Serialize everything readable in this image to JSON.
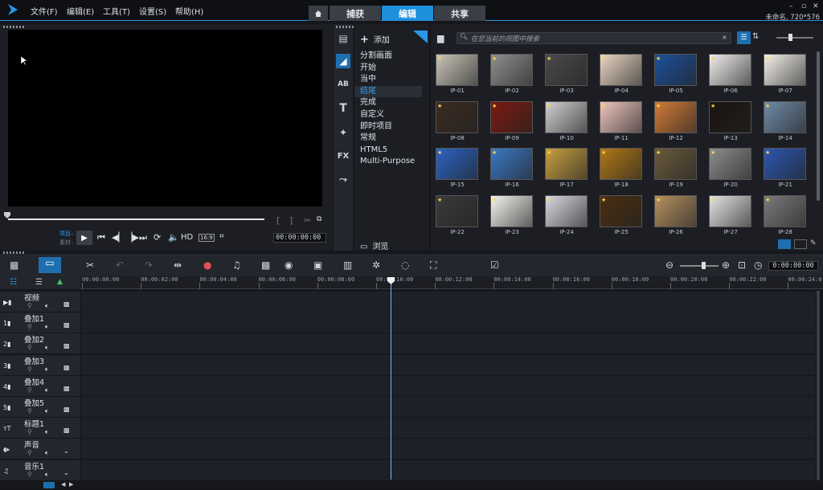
{
  "menu": [
    "文件(F)",
    "编辑(E)",
    "工具(T)",
    "设置(S)",
    "帮助(H)"
  ],
  "tabs": [
    "捕获",
    "编辑",
    "共享"
  ],
  "window_buttons": [
    "–",
    "▫",
    "✕"
  ],
  "project_info": "未命名, 720*576",
  "preview": {
    "project_label": "项目–",
    "clip_label": "素材–",
    "timecode": "00:00:00:00",
    "hd_label": "HD",
    "aspect_label": "16:9"
  },
  "library": {
    "add_label": "添加",
    "categories": [
      "分割画面",
      "开始",
      "当中",
      "结尾",
      "完成",
      "自定义",
      "即时项目",
      "常规",
      "HTML5",
      "Multi-Purpose"
    ],
    "active_category": "结尾",
    "browse_label": "浏览",
    "search_placeholder": "在您当前的视图中搜索",
    "thumbnails": [
      "IP-01",
      "IP-02",
      "IP-03",
      "IP-04",
      "IP-05",
      "IP-06",
      "IP-07",
      "IP-08",
      "IP-09",
      "IP-10",
      "IP-11",
      "IP-12",
      "IP-13",
      "IP-14",
      "IP-15",
      "IP-16",
      "IP-17",
      "IP-18",
      "IP-19",
      "IP-20",
      "IP-21",
      "IP-22",
      "IP-23",
      "IP-24",
      "IP-25",
      "IP-26",
      "IP-27",
      "IP-28"
    ],
    "thumb_colors": [
      "#c8c4b8",
      "#8f8f8f",
      "#4a4a4a",
      "#e9d6c4",
      "#1c4f9a",
      "#f0ecec",
      "#f4f1ea",
      "#3a2a20",
      "#7a1a10",
      "#cfcfcf",
      "#eec4bc",
      "#d07a38",
      "#1a1410",
      "#6f8aa6",
      "#2b63c2",
      "#3b78c4",
      "#c8a040",
      "#b07818",
      "#6a5a3c",
      "#8c8c8c",
      "#2c56b0",
      "#3a3a3a",
      "#f4f4f0",
      "#d8d8e0",
      "#4a2e10",
      "#b49060",
      "#e4e4e4",
      "#7a7a7a"
    ]
  },
  "timeline": {
    "timecode": "0:00:00:00",
    "ruler_ticks": [
      "00:00:00:00",
      "00:00:02:00",
      "00:00:04:00",
      "00:00:06:00",
      "00:00:08:00",
      "00:00:10:00",
      "00:00:12:00",
      "00:00:14:00",
      "00:00:16:00",
      "00:00:18:00",
      "00:00:20:00",
      "00:00:22:00",
      "00:00:24:0"
    ],
    "tracks": [
      "视频",
      "叠加1",
      "叠加2",
      "叠加3",
      "叠加4",
      "叠加5",
      "标题1",
      "声音",
      "音乐1"
    ]
  }
}
